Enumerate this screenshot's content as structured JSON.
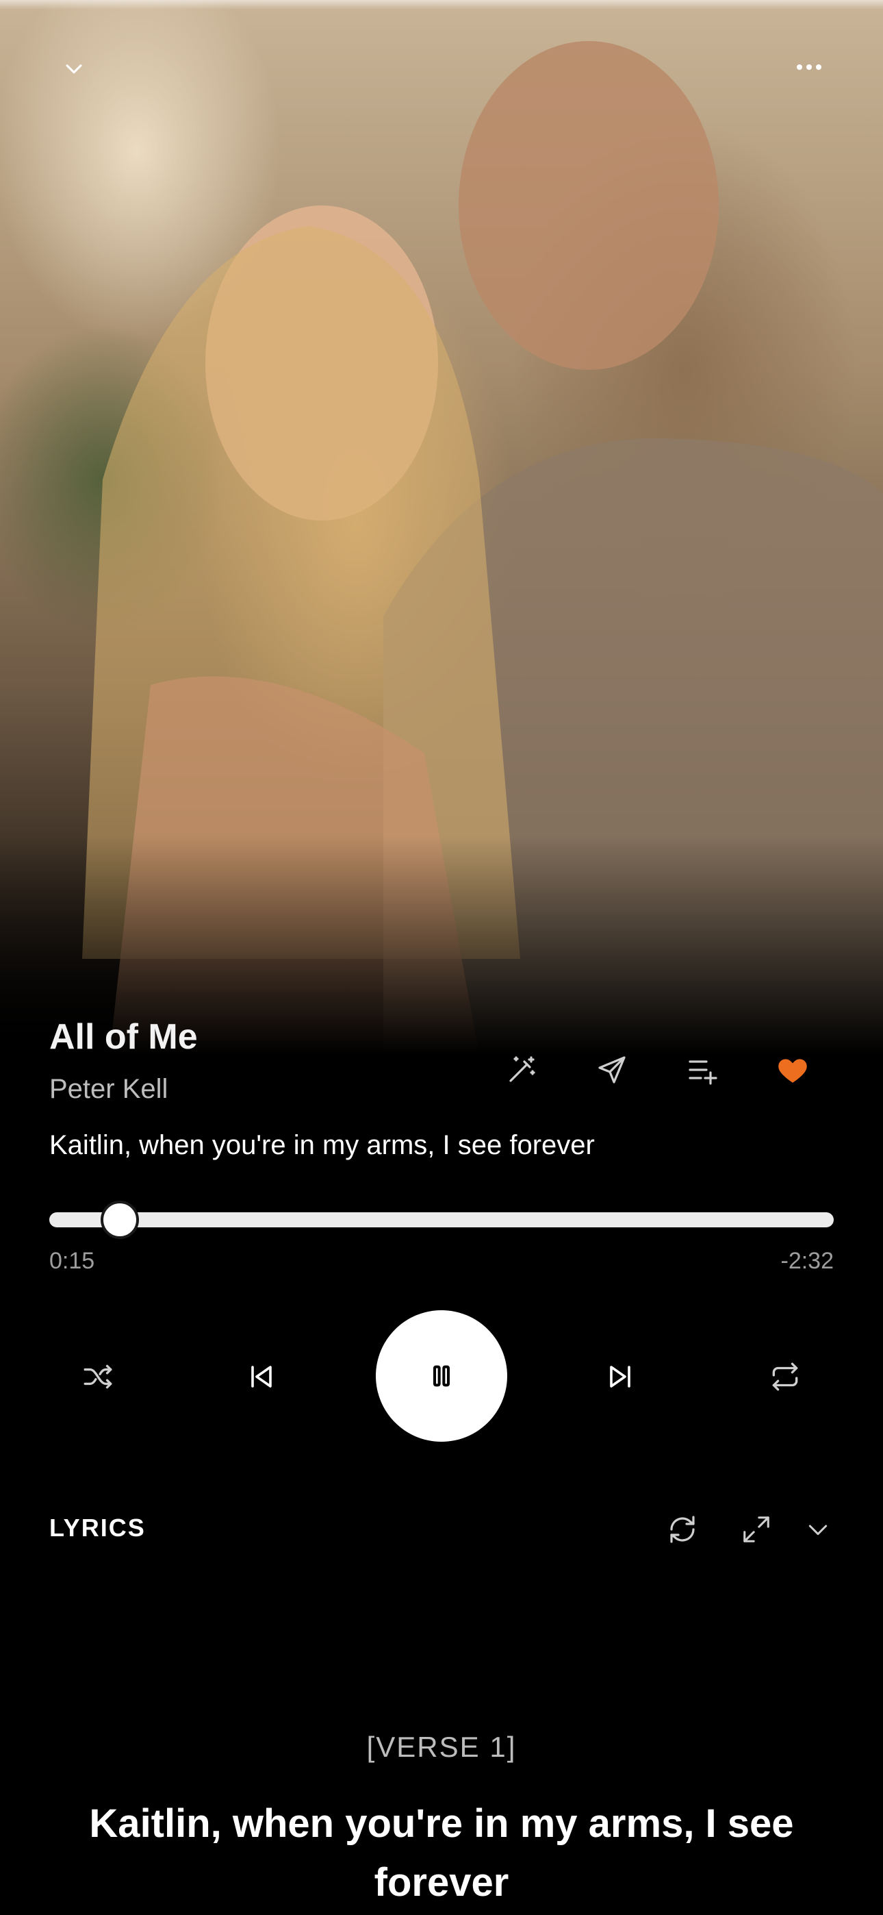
{
  "header": {
    "collapse_icon": "chevron-down-icon",
    "more_icon": "more-horizontal-icon"
  },
  "song": {
    "title": "All of Me",
    "artist": "Peter Kell",
    "current_lyric": "Kaitlin, when you're in my arms, I see forever"
  },
  "actions": {
    "icons": [
      "magic-wand-icon",
      "send-icon",
      "add-to-queue-icon",
      "heart-icon"
    ],
    "liked": true,
    "accent_color": "#ee6e1f"
  },
  "progress": {
    "elapsed": "0:15",
    "remaining": "-2:32",
    "fraction": 0.09
  },
  "controls": {
    "icons": [
      "shuffle-icon",
      "previous-icon",
      "pause-icon",
      "next-icon",
      "repeat-icon"
    ]
  },
  "lyrics": {
    "heading": "LYRICS",
    "section": "[VERSE 1]",
    "line": "Kaitlin, when you're in my arms, I see forever",
    "icons": [
      "refresh-icon",
      "expand-icon",
      "chevron-down-icon"
    ]
  }
}
